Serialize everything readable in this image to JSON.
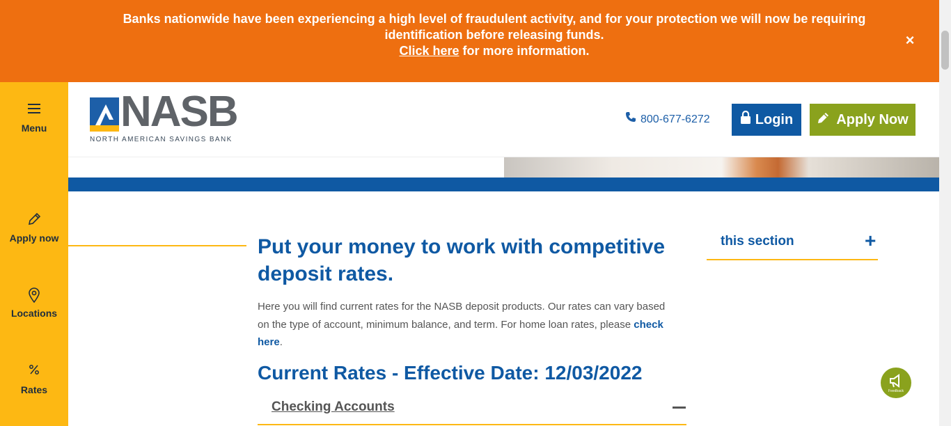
{
  "alert": {
    "line1": "Banks nationwide have been experiencing a high level of fraudulent activity, and for your protection we will now be requiring",
    "line2": "identification before releasing funds.",
    "link": "Click here",
    "after_link": " for more information.",
    "close": "×"
  },
  "sidebar": {
    "menu": "Menu",
    "apply": "Apply now",
    "locations": "Locations",
    "rates": "Rates"
  },
  "header": {
    "logo_text": "NASB",
    "logo_sub": "NORTH AMERICAN SAVINGS BANK",
    "phone": "800-677-6272",
    "login": "Login",
    "apply": "Apply Now"
  },
  "main": {
    "title": "Put your money to work with competitive deposit rates.",
    "intro": "Here you will find current rates for the NASB deposit products. Our rates can vary based on the type of account, minimum balance, and term. For home loan rates, please ",
    "intro_link": "check here",
    "intro_end": ".",
    "rates_title": "Current Rates - Effective Date: 12/03/2022",
    "accordion_label": "Checking Accounts"
  },
  "section_nav": {
    "label": "this section",
    "toggle": "+"
  },
  "feedback": {
    "label": "Feedback"
  },
  "colors": {
    "alert": "#ee6f10",
    "brand_blue": "#0f59a3",
    "brand_yellow": "#fdb813",
    "apply_green": "#8aa21d"
  }
}
